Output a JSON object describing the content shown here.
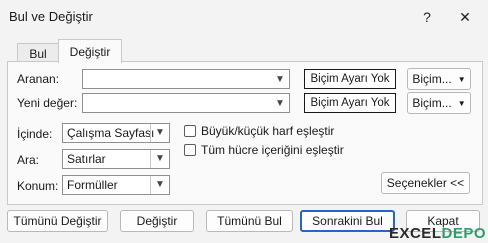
{
  "window": {
    "title": "Bul ve Değiştir",
    "help_glyph": "?",
    "close_glyph": "✕"
  },
  "tabs": [
    {
      "label": "Bul",
      "active": false
    },
    {
      "label": "Değiştir",
      "active": true
    }
  ],
  "find": {
    "label": "Aranan:",
    "value": "",
    "format_preview": "Biçim Ayarı Yok",
    "format_button": "Biçim..."
  },
  "replace": {
    "label": "Yeni değer:",
    "value": "",
    "format_preview": "Biçim Ayarı Yok",
    "format_button": "Biçim..."
  },
  "within": {
    "label": "İçinde:",
    "selected": "Çalışma Sayfası"
  },
  "search": {
    "label": "Ara:",
    "selected": "Satırlar"
  },
  "lookin": {
    "label": "Konum:",
    "selected": "Formüller"
  },
  "match_case": {
    "label": "Büyük/küçük harf eşleştir",
    "checked": false
  },
  "match_entire": {
    "label": "Tüm hücre içeriğini eşleştir",
    "checked": false
  },
  "options_button": "Seçenekler <<",
  "buttons": {
    "replace_all": "Tümünü Değiştir",
    "replace": "Değiştir",
    "find_all": "Tümünü Bul",
    "find_next": "Sonrakini Bul",
    "close": "Kapat"
  },
  "watermark": {
    "prefix": "EXCEL",
    "suffix": "DEPO"
  },
  "colors": {
    "default_button_border": "#2a62c5",
    "background": "#f3f3f3",
    "panel": "#fafafa"
  }
}
